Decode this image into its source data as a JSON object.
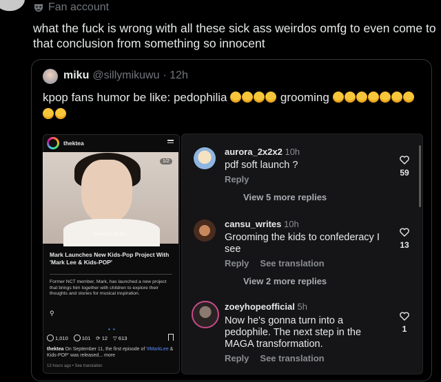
{
  "retweet_header": {
    "label": "Fan account"
  },
  "tweet": {
    "text": "what the fuck is wrong with all these sick ass weirdos omfg to even come to that conclusion from something so innocent"
  },
  "quoted_tweet": {
    "name": "miku",
    "handle": "@sillymikuwu",
    "time": "· 12h",
    "text_a": "kpop fans humor be like: pedophilia ",
    "text_b": " grooming "
  },
  "phone_post": {
    "username": "thektea",
    "image_counter": "1/2",
    "image_caption": "#POP 마크 홍인하리",
    "title": "Mark Launches New Kids-Pop Project With 'Mark Lee & Kids-POP'",
    "body": "Former NCT member, Mark, has launched a new project that brings him together with children to explore their thoughts and stories for musical inspiration.",
    "dots": "• •",
    "likes": "1,010",
    "comments": "101",
    "reposts": "12",
    "shares": "613",
    "caption_user": "thektea",
    "caption_text": " On September 11, the first episode of '",
    "caption_tag": "#MarkLee",
    "caption_rest": " & Kids-POP' was released... ",
    "caption_more": "more",
    "meta": "13 hours ago  •  See translation"
  },
  "comments": [
    {
      "user": "aurora_2x2x2",
      "time": "10h",
      "text": "pdf soft launch ?",
      "reply": "Reply",
      "translate": "",
      "likes": "59",
      "view_more": "View 5 more replies"
    },
    {
      "user": "cansu_writes",
      "time": "10h",
      "text": "Grooming the kids to confederacy I see",
      "reply": "Reply",
      "translate": "See translation",
      "likes": "13",
      "view_more": "View 2 more replies"
    },
    {
      "user": "zoeyhopeofficial",
      "time": "5h",
      "text": "Now he's gonna turn into a pedophile. The next step in the MAGA transformation.",
      "reply": "Reply",
      "translate": "See translation",
      "likes": "1",
      "view_more": ""
    }
  ]
}
